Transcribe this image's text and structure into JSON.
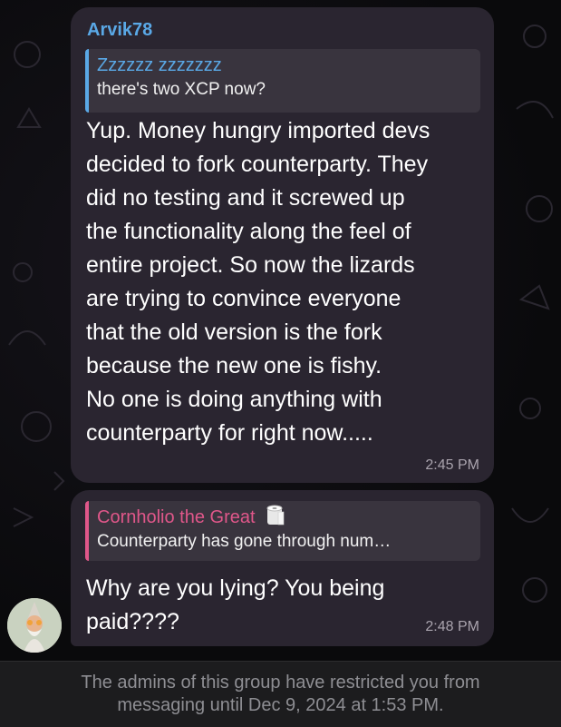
{
  "messages": [
    {
      "sender": "Arvik78",
      "reply": {
        "author": "Zzzzzz zzzzzzz",
        "text": "there's two XCP now?"
      },
      "text": "Yup. Money hungry imported devs\ndecided to fork counterparty. They\ndid no testing and it screwed up\nthe functionality along the feel of\nentire project. So now the lizards\nare trying to convince everyone\nthat the old version is the fork\nbecause the new one is fishy.\nNo one is doing anything with\ncounterparty for right now.....",
      "time": "2:45 PM"
    },
    {
      "reply": {
        "author": "Cornholio the Great",
        "author_icon": "toilet-paper-icon",
        "text": "Counterparty has gone through num…"
      },
      "text": "Why are you lying? You being\npaid????",
      "time": "2:48 PM"
    }
  ],
  "restriction_notice": "The admins of this group have restricted you from messaging until Dec 9, 2024 at 1:53 PM.",
  "colors": {
    "bubble": "#2a2530",
    "sender_blue": "#5aa8e6",
    "reply_pink": "#e0578a",
    "footer_bg": "#1c1c1e",
    "footer_text": "#8e8e93"
  }
}
